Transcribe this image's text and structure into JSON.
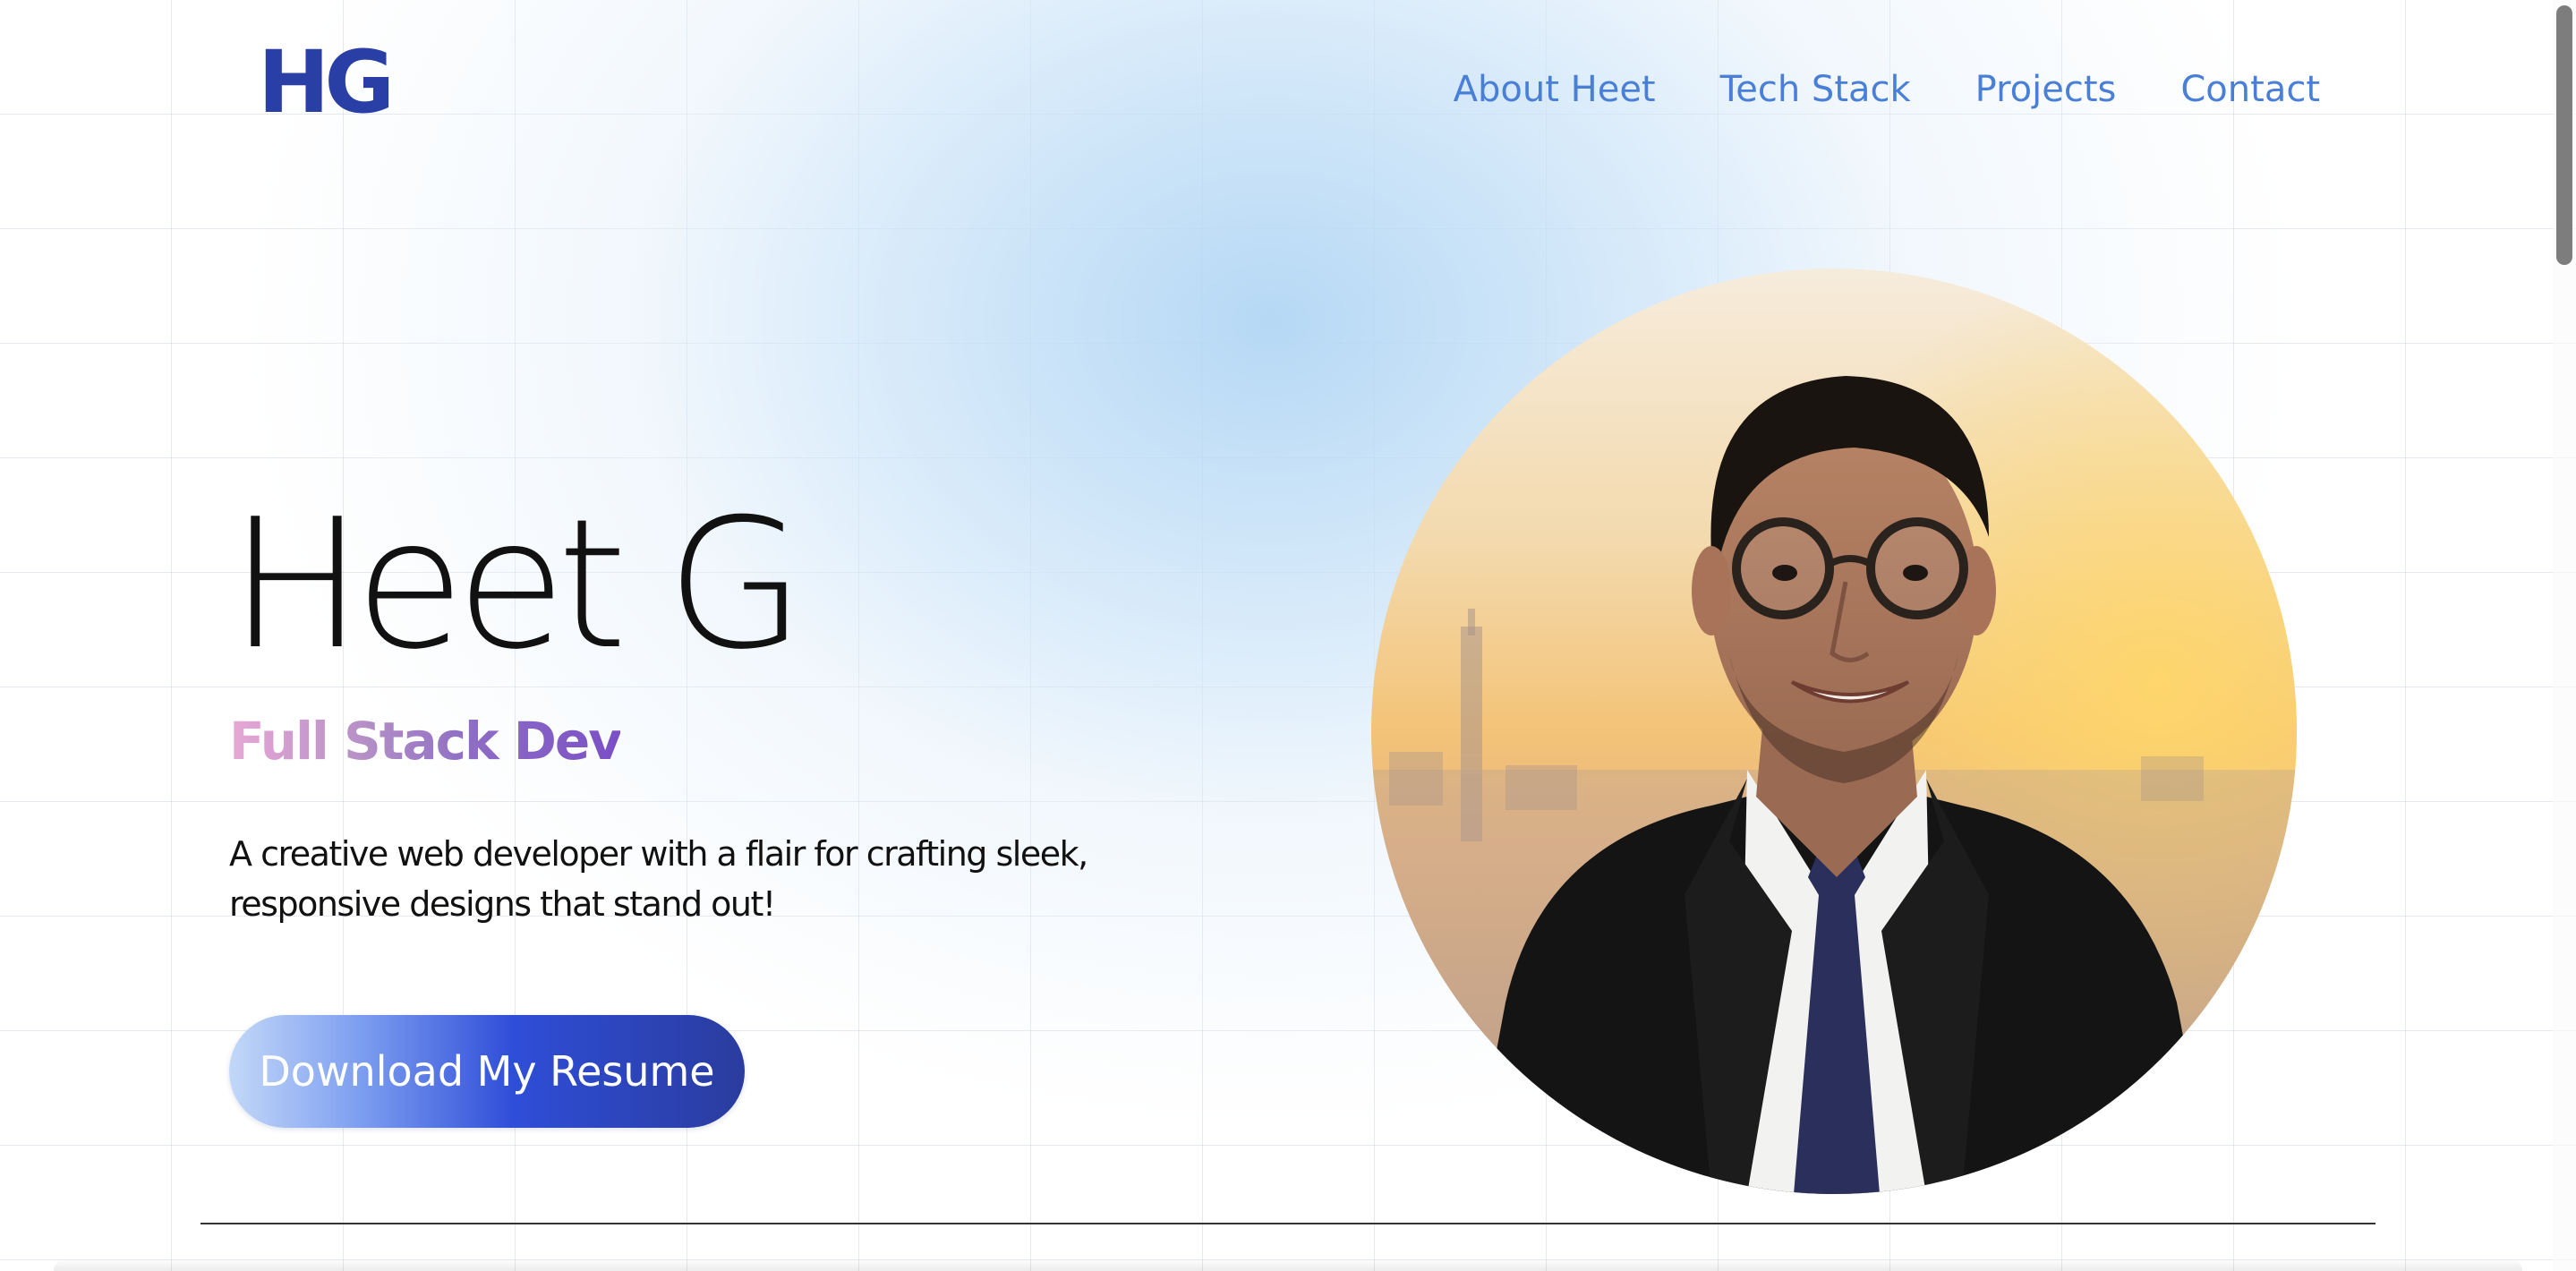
{
  "header": {
    "logo": "HG",
    "nav": [
      {
        "label": "About Heet"
      },
      {
        "label": "Tech Stack"
      },
      {
        "label": "Projects"
      },
      {
        "label": "Contact"
      }
    ]
  },
  "hero": {
    "name": "Heet G",
    "role": "Full Stack Dev",
    "description": "A creative web developer with a flair for crafting sleek, responsive designs that stand out!",
    "resume_button": "Download My Resume"
  },
  "colors": {
    "logo": "#2a3fa5",
    "nav_link": "#4a7fd8",
    "button_gradient_start": "#c3d8f8",
    "button_gradient_end": "#2a3c9e",
    "role_gradient_start": "#e8a8d6",
    "role_gradient_end": "#7a4fc6"
  },
  "icons": {
    "portrait": "profile-photo"
  }
}
